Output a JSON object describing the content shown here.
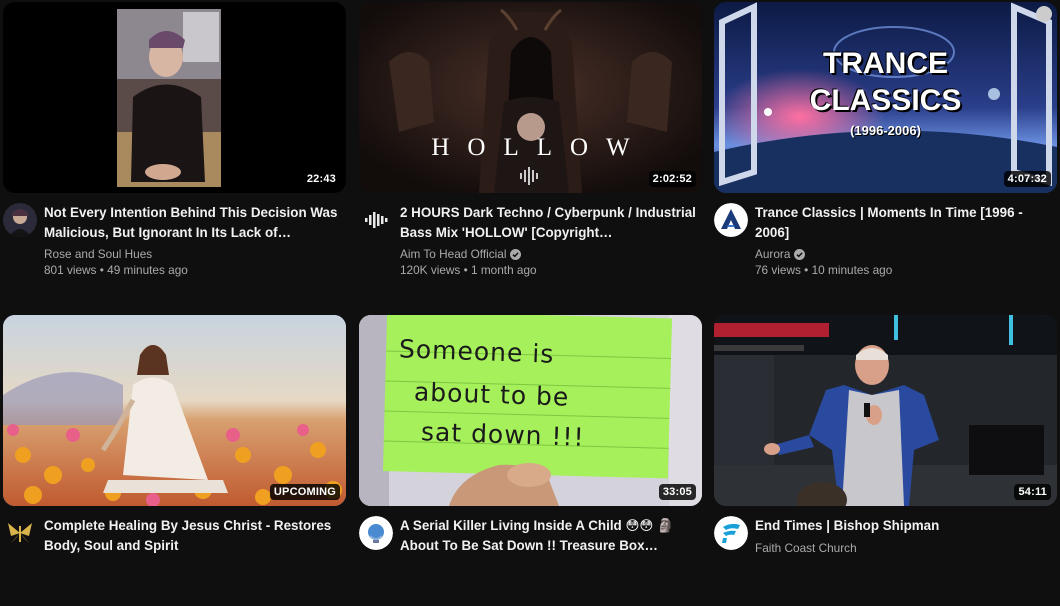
{
  "videos": [
    {
      "title": "Not Every Intention Behind This Decision Was Malicious, But Ignorant In Its Lack of…",
      "channel": "Rose and Soul Hues",
      "views": "801 views",
      "age": "49 minutes ago",
      "duration": "22:43",
      "verified": false,
      "avatar_icon": "person-avatar"
    },
    {
      "title": "2 HOURS Dark Techno / Cyberpunk / Industrial Bass Mix 'HOLLOW' [Copyright…",
      "channel": "Aim To Head Official",
      "views": "120K views",
      "age": "1 month ago",
      "duration": "2:02:52",
      "verified": true,
      "thumb_text": "HOLLOW",
      "avatar_icon": "waveform-icon"
    },
    {
      "title": "Trance Classics | Moments In Time [1996 - 2006]",
      "channel": "Aurora",
      "views": "76 views",
      "age": "10 minutes ago",
      "duration": "4:07:32",
      "verified": true,
      "thumb_text_main1": "TRANCE",
      "thumb_text_main2": "CLASSICS",
      "thumb_text_sub": "(1996-2006)",
      "avatar_icon": "aurora-a-logo"
    },
    {
      "title": "Complete Healing By Jesus Christ - Restores Body, Soul and Spirit",
      "channel": "",
      "views": "",
      "age": "",
      "duration": "UPCOMING",
      "verified": false,
      "avatar_icon": "butterfly-emblem"
    },
    {
      "title": "A Serial Killer Living Inside A Child 😳😳 🗿 About To Be Sat Down !! Treasure Box…",
      "channel": "",
      "views": "",
      "age": "",
      "duration": "33:05",
      "verified": false,
      "thumb_text_line1": "Someone is",
      "thumb_text_line2": "about to be",
      "thumb_text_line3": "sat down !!!",
      "avatar_icon": "globe-emblem"
    },
    {
      "title": "End Times | Bishop Shipman",
      "channel": "Faith Coast Church",
      "views": "",
      "age": "",
      "duration": "54:11",
      "verified": false,
      "avatar_icon": "faith-coast-logo"
    }
  ],
  "colors": {
    "background": "#0f0f0f",
    "text": "#f1f1f1",
    "secondary": "#aaaaaa"
  }
}
